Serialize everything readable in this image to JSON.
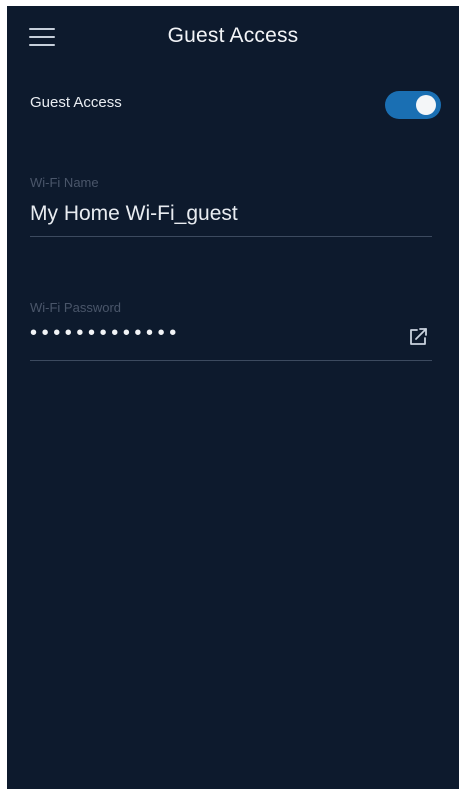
{
  "header": {
    "title": "Guest Access",
    "menu_icon": "hamburger-menu-icon"
  },
  "guest_access": {
    "label": "Guest Access",
    "enabled": true,
    "toggle_color": "#1a6fb3"
  },
  "wifi_name": {
    "label": "Wi-Fi Name",
    "value": "My Home Wi-Fi_guest"
  },
  "wifi_password": {
    "label": "Wi-Fi Password",
    "masked_value": "•••••••••••••",
    "edit_icon": "external-edit-icon"
  },
  "colors": {
    "background": "#0d1a2d",
    "accent": "#1a6fb3"
  }
}
